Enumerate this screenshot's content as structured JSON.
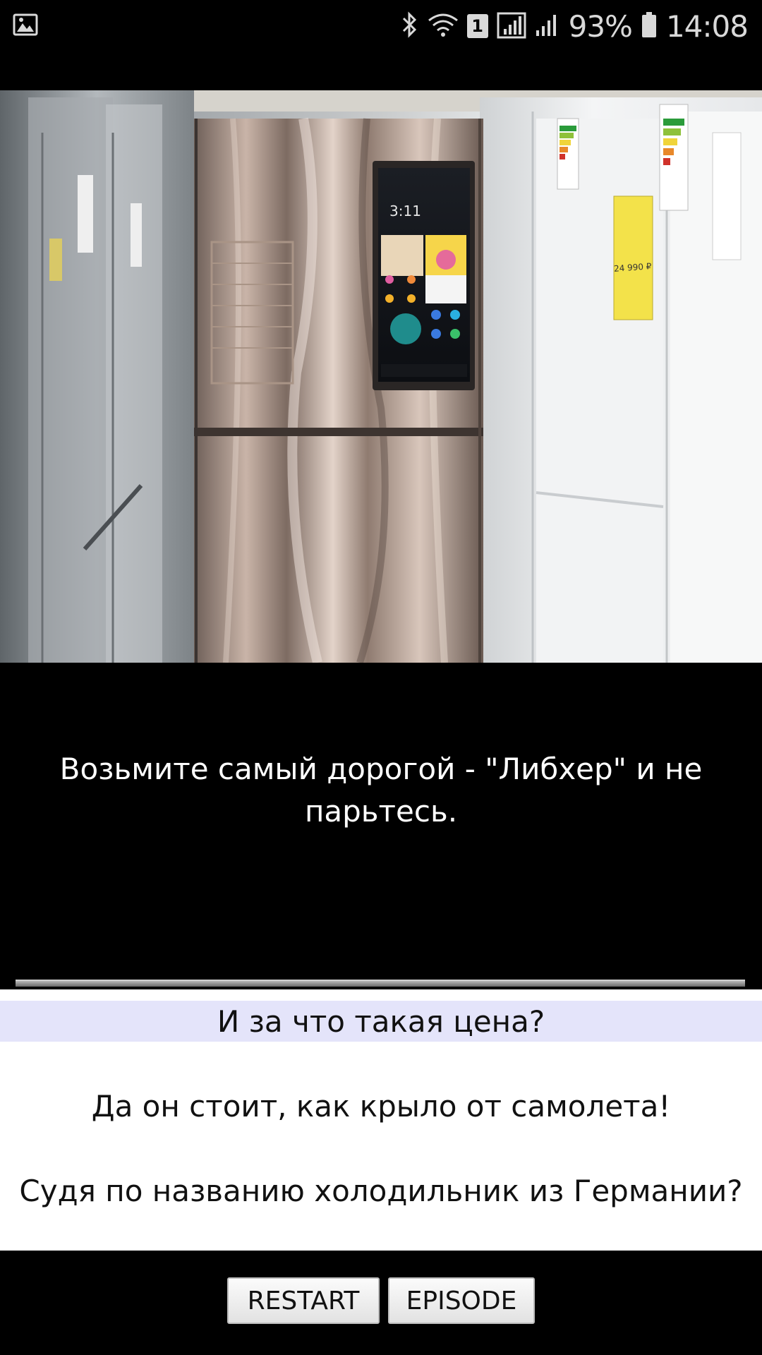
{
  "status_bar": {
    "gallery_icon": "image-icon",
    "icons": [
      "bluetooth-icon",
      "wifi-icon",
      "sim-1-badge",
      "signal-icon",
      "signal-icon-2",
      "battery-icon"
    ],
    "sim_slot": "1",
    "battery_percent": "93%",
    "time": "14:08"
  },
  "scene": {
    "image_subject": "stainless-steel refrigerator with touchscreen in appliance store",
    "screen_time": "3:11",
    "price_tag": "24 990 ₽"
  },
  "narration": {
    "line1": "Возьмите самый дорогой - \"Либхер\" и не",
    "line2": "парьтесь."
  },
  "choices": [
    {
      "label": "И за что такая цена?",
      "selected": true
    },
    {
      "label": "Да он стоит, как крыло от самолета!",
      "selected": false
    },
    {
      "label": "Судя по названию холодильник из Германии?",
      "selected": false
    }
  ],
  "buttons": {
    "restart_label": "RESTART",
    "episode_label": "EPISODE"
  },
  "colors": {
    "background": "#000000",
    "selected_choice_bg": "#e4e4fa",
    "choice_panel_bg": "#ffffff"
  }
}
